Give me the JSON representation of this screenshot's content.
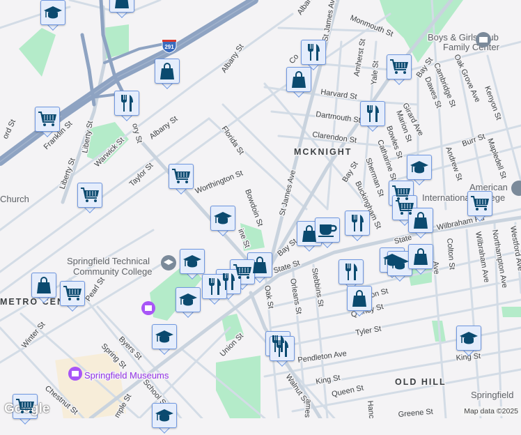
{
  "map": {
    "highway_shield": "291",
    "neighborhoods": [
      "MCKNIGHT",
      "METRO CENT",
      "OLD HILL"
    ],
    "places": {
      "stcc_line1": "Springfield Technical",
      "stcc_line2": "Community College",
      "boys_girls_line1": "Boys & Girls Club",
      "boys_girls_line2": "Family Center",
      "aic_line1": "American",
      "aic_line2": "International College",
      "museums": "Springfield Museums",
      "church": "Church",
      "springfield": "Springfield"
    },
    "streets": {
      "albany1": "Albany St",
      "albany2": "Albany St",
      "albany3": "Albany St",
      "st_james1": "St James Ave",
      "st_james2": "St James Ave",
      "monmouth": "Monmouth St",
      "amherst": "Amherst St",
      "yale": "Yale St",
      "harvard": "Harvard St",
      "dartmouth": "Dartmouth St",
      "clarendon": "Clarendon St",
      "bay1": "Bay St",
      "bay2": "Bay St",
      "bay3": "Bay St",
      "cambridge": "Cambridge St",
      "dawes": "Dawes St",
      "oak_grove": "Oak Grove Ave",
      "kenyon": "Kenyon St",
      "girard": "Girard Ave",
      "marion": "Marion St",
      "bowles": "Bowles St",
      "catharine": "Catharine St",
      "sherman": "Sherman St",
      "buckingham": "Buckingham St",
      "burr": "Burr St",
      "andrew": "Andrew St",
      "mapledell": "Mapledell St",
      "florida": "Florida St",
      "worthington": "Worthington St",
      "bowdoin": "Bowdoin St",
      "taylor": "Taylor St",
      "warwick": "Warwick St",
      "liberty1": "Liberty St",
      "liberty2": "Liberty St",
      "franklin": "Franklin St",
      "ford": "ord St",
      "dory": "ory St",
      "pine": "ine St",
      "corn": "Co",
      "wilbraham_rd": "Wilbraham Rd",
      "state1": "State St",
      "state2": "State",
      "colton": "Colton St",
      "wilbraham_ave": "Wilbraham Ave",
      "northampton": "Northampton Ave",
      "westford": "Westford Ave",
      "oak": "Oak St",
      "orleans": "Orleans St",
      "stebbins": "Stebbins St",
      "quincy": "Quincy St",
      "mason": "on St",
      "tyler": "Tyler St",
      "pendleton": "Pendleton Ave",
      "king1": "King St",
      "king2": "King St",
      "queen": "Queen St",
      "greene": "Greene St",
      "walnut": "Walnut St",
      "hanc": "Hanc",
      "ames": "ames St",
      "pearl": "Pearl St",
      "winter": "Winter St",
      "byers": "Byers St",
      "spring": "Spring St",
      "school": "School St",
      "union": "Union St",
      "chestnut": "Chestnut St",
      "temple": "mple St",
      "e_ave": "Ave"
    },
    "markers": [
      "education",
      "shopping",
      "shopping",
      "restaurant",
      "grocery",
      "grocery",
      "grocery",
      "education",
      "restaurant",
      "shopping",
      "grocery",
      "restaurant",
      "education",
      "grocery",
      "grocery",
      "grocery",
      "shopping",
      "shopping",
      "cafe",
      "restaurant",
      "education",
      "education",
      "shopping",
      "restaurant",
      "shopping",
      "education",
      "shopping",
      "grocery",
      "restaurant",
      "restaurant",
      "education",
      "shopping",
      "grocery",
      "education",
      "restaurant",
      "restaurant",
      "education",
      "education",
      "grocery"
    ],
    "attribution": {
      "logo": "Google",
      "map_data": "Map data ©2025"
    },
    "colors": {
      "marker_icon": "#0b4a6f",
      "marker_bg": "#e5edfc",
      "marker_border": "#6f97e0",
      "park": "#b4ebc9",
      "highway": "#8ea3c2",
      "road": "#d3dce6"
    }
  }
}
